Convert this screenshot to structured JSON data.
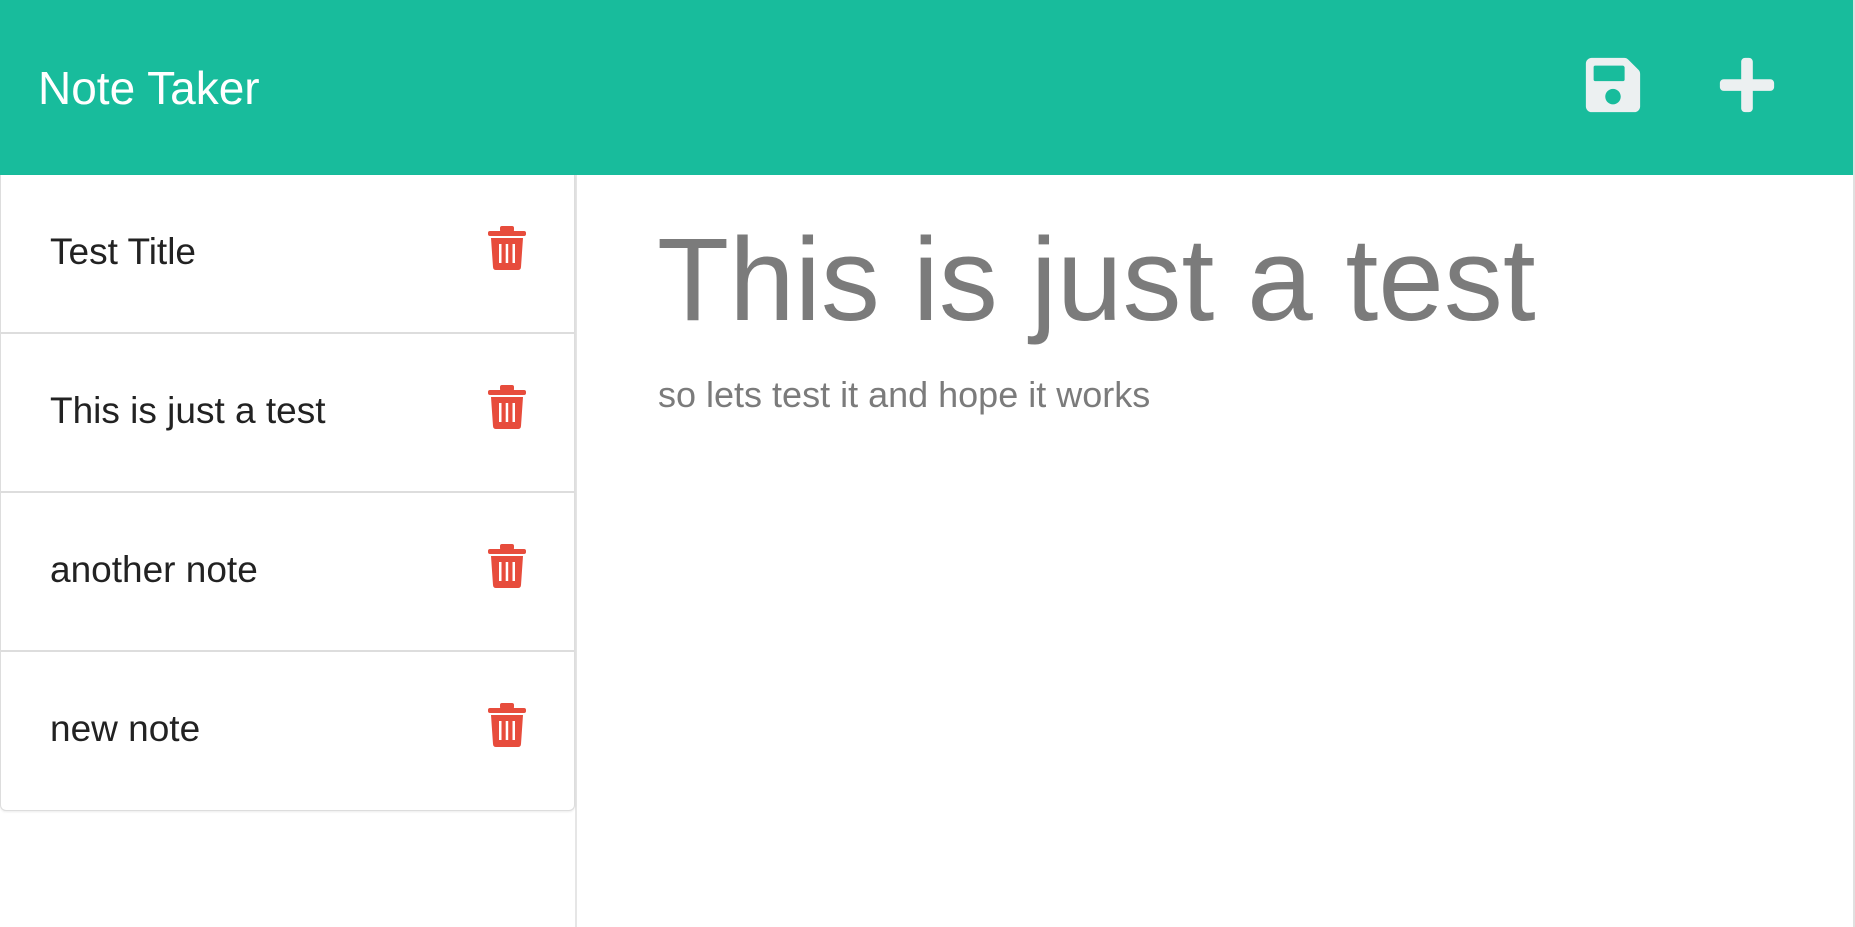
{
  "app": {
    "title": "Note Taker"
  },
  "toolbar": {
    "save_icon": "save-icon",
    "new_icon": "plus-icon"
  },
  "colors": {
    "navbar": "#18bc9c",
    "delete": "#e74c3c",
    "text_muted": "#7b7b7b"
  },
  "notes": [
    {
      "title": "Test Title",
      "delete_icon": "trash-icon"
    },
    {
      "title": "This is just a test",
      "delete_icon": "trash-icon"
    },
    {
      "title": "another note",
      "delete_icon": "trash-icon"
    },
    {
      "title": "new note",
      "delete_icon": "trash-icon"
    }
  ],
  "active_note": {
    "title": "This is just a test",
    "text": "so lets test it and hope it works"
  }
}
